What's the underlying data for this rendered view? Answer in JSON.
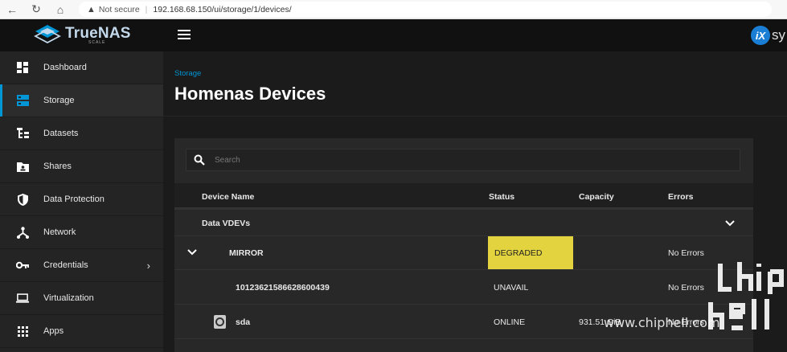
{
  "browser": {
    "back": "←",
    "reload": "↻",
    "home": "⌂",
    "security_label": "Not secure",
    "url": "192.168.68.150/ui/storage/1/devices/"
  },
  "header": {
    "logo_text": "TrueNAS",
    "logo_sub": "SCALE",
    "vendor_short": "iX",
    "vendor_text": "sy"
  },
  "sidebar": {
    "items": [
      {
        "label": "Dashboard",
        "icon": "dashboard-icon"
      },
      {
        "label": "Storage",
        "icon": "storage-icon",
        "active": true
      },
      {
        "label": "Datasets",
        "icon": "datasets-icon"
      },
      {
        "label": "Shares",
        "icon": "shares-icon"
      },
      {
        "label": "Data Protection",
        "icon": "shield-icon"
      },
      {
        "label": "Network",
        "icon": "network-icon"
      },
      {
        "label": "Credentials",
        "icon": "key-icon",
        "has_submenu": true
      },
      {
        "label": "Virtualization",
        "icon": "laptop-icon"
      },
      {
        "label": "Apps",
        "icon": "apps-grid-icon"
      }
    ],
    "submenu_chevron": "›"
  },
  "main": {
    "breadcrumb": "Storage",
    "title": "Homenas Devices",
    "search_placeholder": "Search",
    "columns": {
      "device": "Device Name",
      "status": "Status",
      "capacity": "Capacity",
      "errors": "Errors"
    },
    "group_label": "Data VDEVs",
    "rows": [
      {
        "name": "MIRROR",
        "status": "DEGRADED",
        "capacity": "",
        "errors": "No Errors"
      },
      {
        "name": "10123621586628600439",
        "status": "UNAVAIL",
        "capacity": "",
        "errors": "No Errors"
      },
      {
        "name": "sda",
        "status": "ONLINE",
        "capacity": "931.51 GiB",
        "errors": "No Errors"
      }
    ],
    "degraded_color": "#e2d33f"
  },
  "watermark": {
    "text": "www.chiphell.com"
  },
  "colors": {
    "accent": "#0095d5",
    "sidebar_bg": "#242424",
    "header_bg": "#111111"
  }
}
